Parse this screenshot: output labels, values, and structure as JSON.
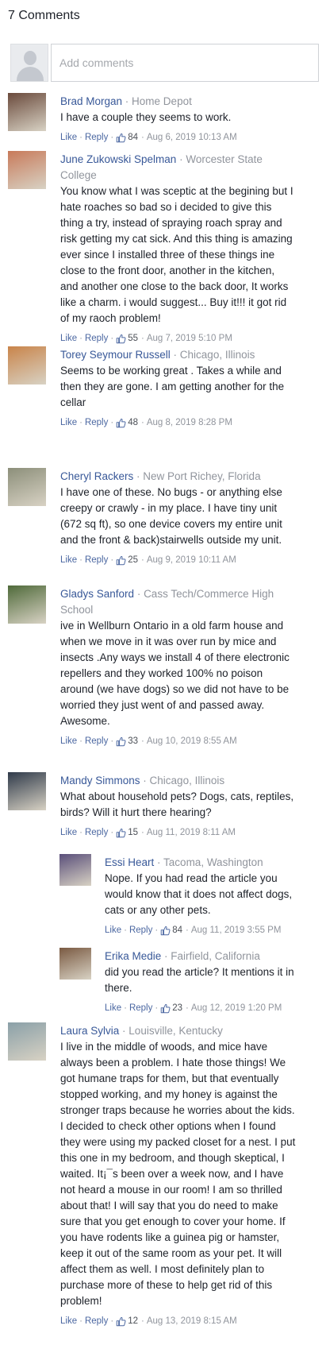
{
  "header": {
    "comment_count": "7 Comments"
  },
  "composer": {
    "placeholder": "Add comments"
  },
  "actions": {
    "like": "Like",
    "reply": "Reply"
  },
  "comments": [
    {
      "author": "Brad Morgan",
      "affiliation": "Home Depot",
      "text": "I have a couple they seems to work.",
      "likes": "84",
      "timestamp": "Aug 6, 2019 10:13 AM",
      "avatar_color": "#6a4a3c"
    },
    {
      "author": "June Zukowski Spelman",
      "affiliation": "Worcester State College",
      "text": "You know what I was sceptic at the begining but I hate roaches so bad so i decided to give this thing a try, instead of spraying roach spray and risk getting my cat sick. And this thing is amazing ever since I installed three of these things ine close to the front door, another in the kitchen, and another one close to the back door, It works like a charm. i would suggest... Buy it!!! it got rid of my raoch problem!",
      "likes": "55",
      "timestamp": "Aug 7, 2019 5:10 PM",
      "avatar_color": "#c87a5a"
    },
    {
      "author": "Torey Seymour Russell",
      "affiliation": "Chicago, Illinois",
      "text": "Seems to be working great . Takes a while and then they are gone. I am getting another for the cellar",
      "likes": "48",
      "timestamp": "Aug 8, 2019 8:28 PM",
      "avatar_color": "#c9844a"
    },
    {
      "author": "Cheryl Rackers",
      "affiliation": "New Port Richey, Florida",
      "text": "I have one of these. No bugs - or anything else creepy or crawly - in my place. I have tiny unit (672 sq ft), so one device covers my entire unit and the front & back)stairwells outside my unit.",
      "likes": "25",
      "timestamp": "Aug 9, 2019 10:11 AM",
      "avatar_color": "#8c8f7a"
    },
    {
      "author": "Gladys Sanford",
      "affiliation": "Cass Tech/Commerce High School",
      "text": "ive in Wellburn Ontario in a old farm house and when we move in it was over run by mice and insects .Any ways we install 4 of there electronic repellers and they worked 100% no poison around (we have dogs) so we did not have to be worried they just went of and passed away. Awesome.",
      "likes": "33",
      "timestamp": "Aug 10, 2019 8:55 AM",
      "avatar_color": "#4f6a3a"
    },
    {
      "author": "Mandy Simmons",
      "affiliation": "Chicago, Illinois",
      "text": "What about household pets? Dogs, cats, reptiles, birds? Will it hurt there hearing?",
      "likes": "15",
      "timestamp": "Aug 11, 2019 8:11 AM",
      "avatar_color": "#2f3a4a"
    },
    {
      "author": "Essi Heart",
      "affiliation": "Tacoma, Washington",
      "text": "Nope. If you had read the article you would know that it does not affect dogs, cats or any other pets.",
      "likes": "84",
      "timestamp": "Aug 11, 2019 3:55 PM",
      "avatar_color": "#5a4f7a"
    },
    {
      "author": "Erika Medie",
      "affiliation": "Fairfield, California",
      "text": "did you read the article? It mentions it in there.",
      "likes": "23",
      "timestamp": "Aug 12, 2019 1:20 PM",
      "avatar_color": "#7a5a42"
    },
    {
      "author": "Laura Sylvia",
      "affiliation": "Louisville, Kentucky",
      "text": "I live in the middle of woods, and mice have always been a problem. I hate those things! We got humane traps for them, but that eventually stopped working, and my honey is against the stronger traps because he worries about the kids. I decided to check other options when I found they were using my packed closet for a nest. I put this one in my bedroom, and though skeptical, I waited. It¡¯s been over a week now, and I have not heard a mouse in our room! I am so thrilled about that! I will say that you do need to make sure that you get enough to cover your home. If you have rodents like a guinea pig or hamster, keep it out of the same room as your pet. It will affect them as well. I most definitely plan to purchase more of these to help get rid of this problem!",
      "likes": "12",
      "timestamp": "Aug 13, 2019 8:15 AM",
      "avatar_color": "#8aa0a8"
    }
  ]
}
